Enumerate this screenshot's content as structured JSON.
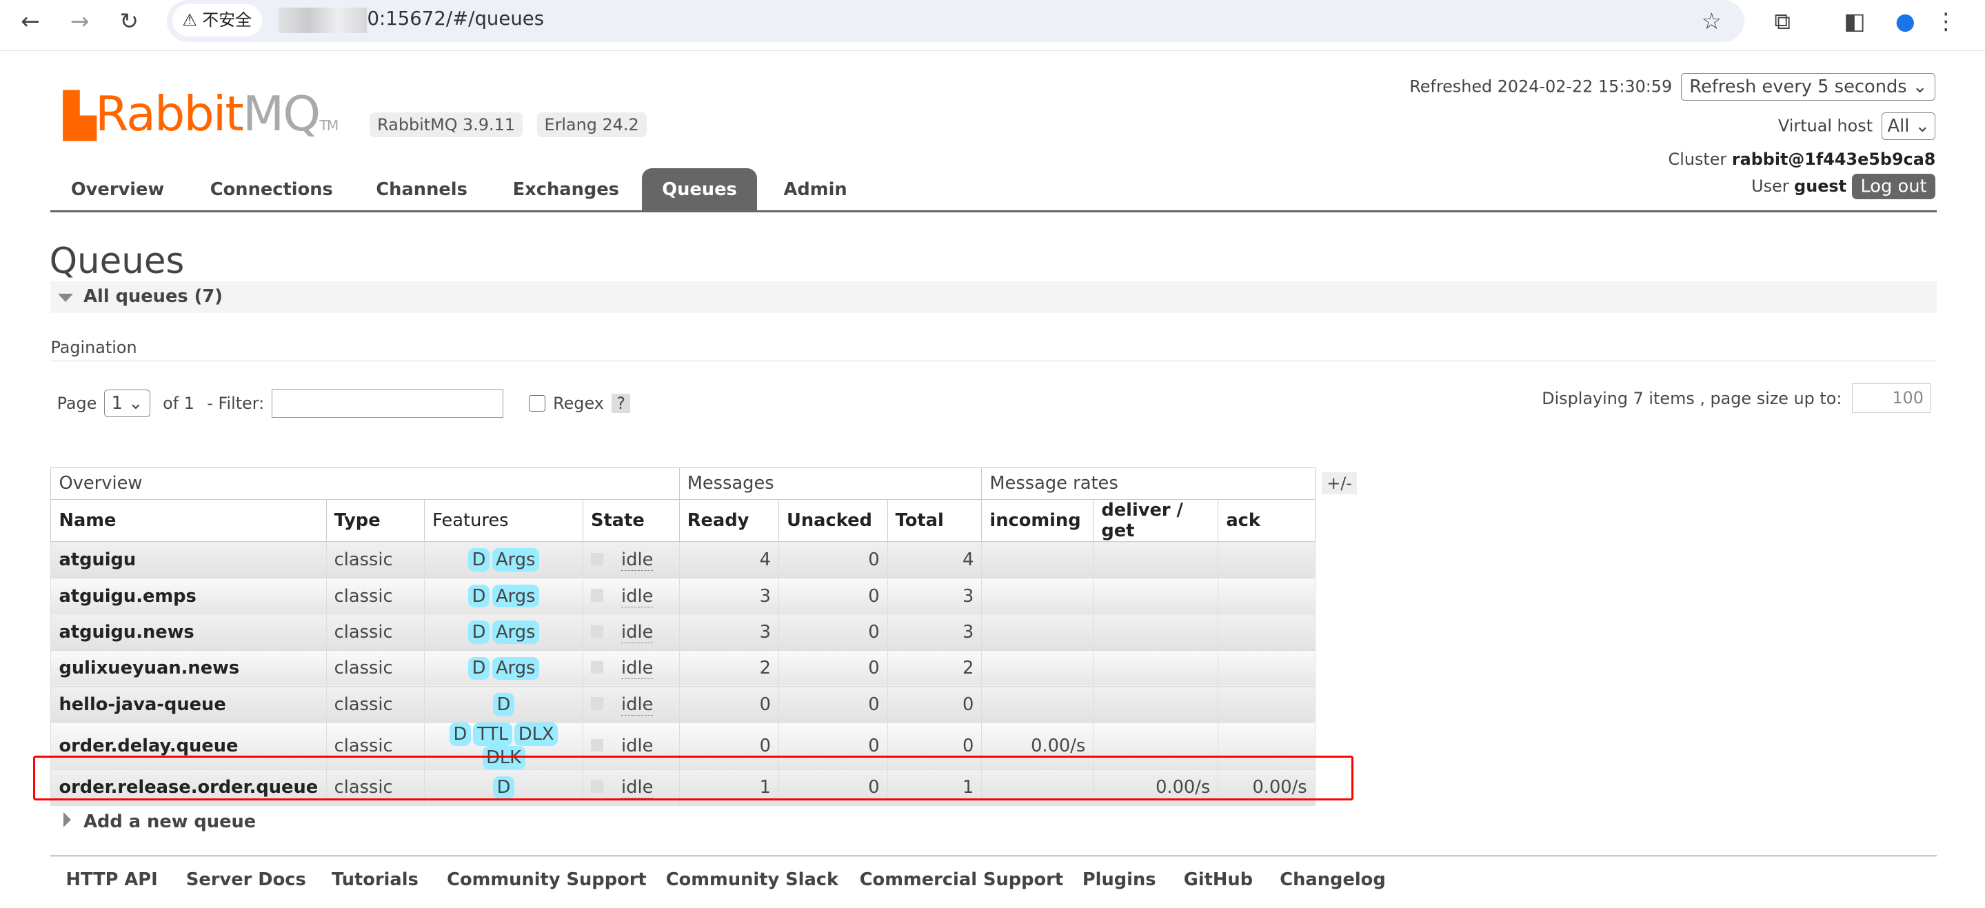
{
  "browser": {
    "insecure_label": "不安全",
    "url": "0:15672/#/queues",
    "icons": [
      "back-icon",
      "forward-icon",
      "reload-icon",
      "warning-icon",
      "star-icon",
      "extensions-icon",
      "sidepanel-icon",
      "profile-icon",
      "menu-icon"
    ]
  },
  "header": {
    "logo_text": "RabbitMQ",
    "badge_version": "RabbitMQ 3.9.11",
    "badge_erlang": "Erlang 24.2",
    "refreshed_label": "Refreshed 2024-02-22 15:30:59",
    "refresh_select": "Refresh every 5 seconds",
    "vhost_label": "Virtual host",
    "vhost_select": "All",
    "cluster_label": "Cluster",
    "cluster_value": "rabbit@1f443e5b9ca8",
    "user_label": "User",
    "user_value": "guest",
    "logout": "Log out"
  },
  "tabs": [
    {
      "label": "Overview"
    },
    {
      "label": "Connections"
    },
    {
      "label": "Channels"
    },
    {
      "label": "Exchanges"
    },
    {
      "label": "Queues",
      "active": true
    },
    {
      "label": "Admin"
    }
  ],
  "page": {
    "title": "Queues",
    "section": "All queues (7)",
    "pagination_label": "Pagination",
    "page_label": "Page",
    "page_value": "1",
    "of_label": "of 1",
    "filter_label": "- Filter:",
    "filter_value": "",
    "regex_label": "Regex",
    "help": "?",
    "displaying": "Displaying 7 items , page size up to:",
    "page_size": "100",
    "plusminus": "+/-",
    "add_queue": "Add a new queue"
  },
  "table": {
    "groups": [
      "Overview",
      "Messages",
      "Message rates"
    ],
    "columns": [
      "Name",
      "Type",
      "Features",
      "State",
      "Ready",
      "Unacked",
      "Total",
      "incoming",
      "deliver / get",
      "ack"
    ],
    "rows": [
      {
        "name": "atguigu",
        "type": "classic",
        "features": [
          "D",
          "Args"
        ],
        "state": "idle",
        "ready": "4",
        "unacked": "0",
        "total": "4",
        "incoming": "",
        "deliver": "",
        "ack": ""
      },
      {
        "name": "atguigu.emps",
        "type": "classic",
        "features": [
          "D",
          "Args"
        ],
        "state": "idle",
        "ready": "3",
        "unacked": "0",
        "total": "3",
        "incoming": "",
        "deliver": "",
        "ack": ""
      },
      {
        "name": "atguigu.news",
        "type": "classic",
        "features": [
          "D",
          "Args"
        ],
        "state": "idle",
        "ready": "3",
        "unacked": "0",
        "total": "3",
        "incoming": "",
        "deliver": "",
        "ack": ""
      },
      {
        "name": "gulixueyuan.news",
        "type": "classic",
        "features": [
          "D",
          "Args"
        ],
        "state": "idle",
        "ready": "2",
        "unacked": "0",
        "total": "2",
        "incoming": "",
        "deliver": "",
        "ack": ""
      },
      {
        "name": "hello-java-queue",
        "type": "classic",
        "features": [
          "D"
        ],
        "state": "idle",
        "ready": "0",
        "unacked": "0",
        "total": "0",
        "incoming": "",
        "deliver": "",
        "ack": ""
      },
      {
        "name": "order.delay.queue",
        "type": "classic",
        "features": [
          "D",
          "TTL",
          "DLX",
          "DLK"
        ],
        "state": "idle",
        "ready": "0",
        "unacked": "0",
        "total": "0",
        "incoming": "0.00/s",
        "deliver": "",
        "ack": ""
      },
      {
        "name": "order.release.order.queue",
        "type": "classic",
        "features": [
          "D"
        ],
        "state": "idle",
        "ready": "1",
        "unacked": "0",
        "total": "1",
        "incoming": "",
        "deliver": "0.00/s",
        "ack": "0.00/s"
      }
    ]
  },
  "footer": [
    "HTTP API",
    "Server Docs",
    "Tutorials",
    "Community Support",
    "Community Slack",
    "Commercial Support",
    "Plugins",
    "GitHub",
    "Changelog"
  ],
  "colors": {
    "brand": "#ff6600",
    "active_tab": "#666666",
    "feature_tag": "#99ebff",
    "highlight": "#ff0000"
  }
}
